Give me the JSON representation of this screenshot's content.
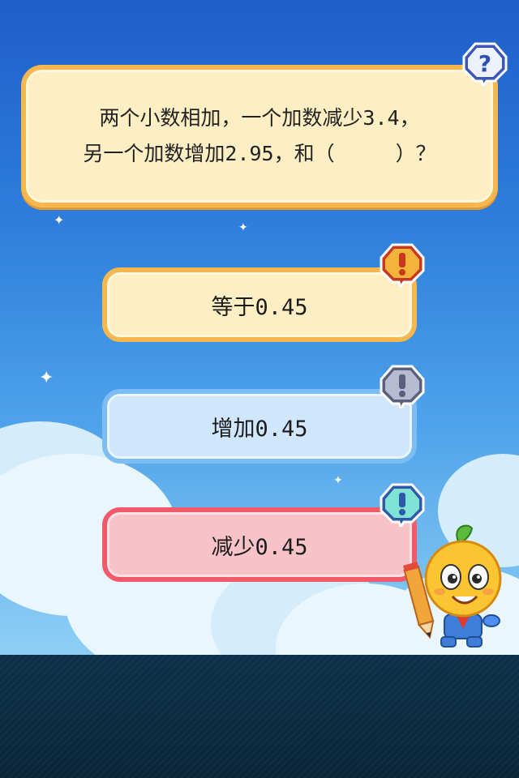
{
  "question": {
    "text": "两个小数相加，一个加数减少3.4，\n另一个加数增加2.95，和（　　　）？",
    "badge_icon": "question-mark-icon"
  },
  "answers": [
    {
      "label": "等于0.45",
      "badge_icon": "exclamation-icon",
      "color": "#f6b84e"
    },
    {
      "label": "增加0.45",
      "badge_icon": "exclamation-icon",
      "color": "#7cbdf3"
    },
    {
      "label": "减少0.45",
      "badge_icon": "exclamation-icon",
      "color": "#f05a69"
    }
  ],
  "mascot": {
    "icon": "orange-mascot-with-pencil-icon"
  }
}
